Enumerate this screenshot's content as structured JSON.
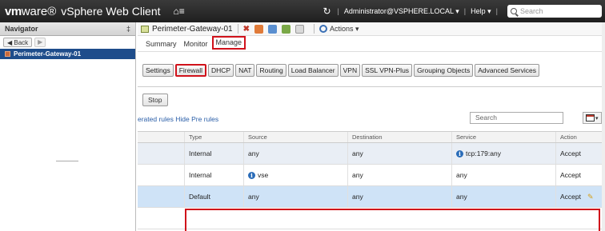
{
  "header": {
    "brand_vm": "vm",
    "brand_ware": "ware®",
    "product": "vSphere Web Client",
    "home_icon": "⌂≡",
    "refresh_icon": "↻",
    "user": "Administrator@VSPHERE.LOCAL",
    "user_caret": "▾",
    "help": "Help",
    "help_caret": "▾",
    "separator": "|",
    "search_placeholder": "Search"
  },
  "navigator": {
    "title": "Navigator",
    "pin_icon": "‡",
    "back_label": "◀ Back",
    "forward_icon": "▶",
    "selected_item": "Perimeter-Gateway-01"
  },
  "object": {
    "title": "Perimeter-Gateway-01",
    "actions_label": "Actions ▾",
    "close_icon": "✖"
  },
  "tabs": [
    {
      "label": "Summary"
    },
    {
      "label": "Monitor"
    },
    {
      "label": "Manage",
      "active": true
    }
  ],
  "subtabs": [
    {
      "label": "Settings"
    },
    {
      "label": "Firewall",
      "active": true
    },
    {
      "label": "DHCP"
    },
    {
      "label": "NAT"
    },
    {
      "label": "Routing"
    },
    {
      "label": "Load Balancer"
    },
    {
      "label": "VPN"
    },
    {
      "label": "SSL VPN-Plus"
    },
    {
      "label": "Grouping Objects"
    },
    {
      "label": "Advanced Services"
    }
  ],
  "firewall": {
    "stop_button": "Stop",
    "rules_link_1": "erated rules",
    "rules_link_2": "Hide Pre rules",
    "search_placeholder": "Search",
    "columns": [
      "Type",
      "Source",
      "Destination",
      "Service",
      "Action"
    ],
    "rows": [
      {
        "type": "Internal",
        "source": "any",
        "destination": "any",
        "service": "tcp:179:any",
        "service_info": true,
        "action": "Accept"
      },
      {
        "type": "Internal",
        "source": "vse",
        "source_info": true,
        "destination": "any",
        "service": "any",
        "action": "Accept"
      },
      {
        "type": "Default",
        "source": "any",
        "destination": "any",
        "service": "any",
        "action": "Accept",
        "selected": true
      }
    ],
    "info_glyph": "i",
    "edit_icon": "✎"
  },
  "colors": {
    "highlight_red": "#d0121b",
    "nav_selected": "#1e4d8b",
    "row_selected": "#cfe3f7"
  }
}
